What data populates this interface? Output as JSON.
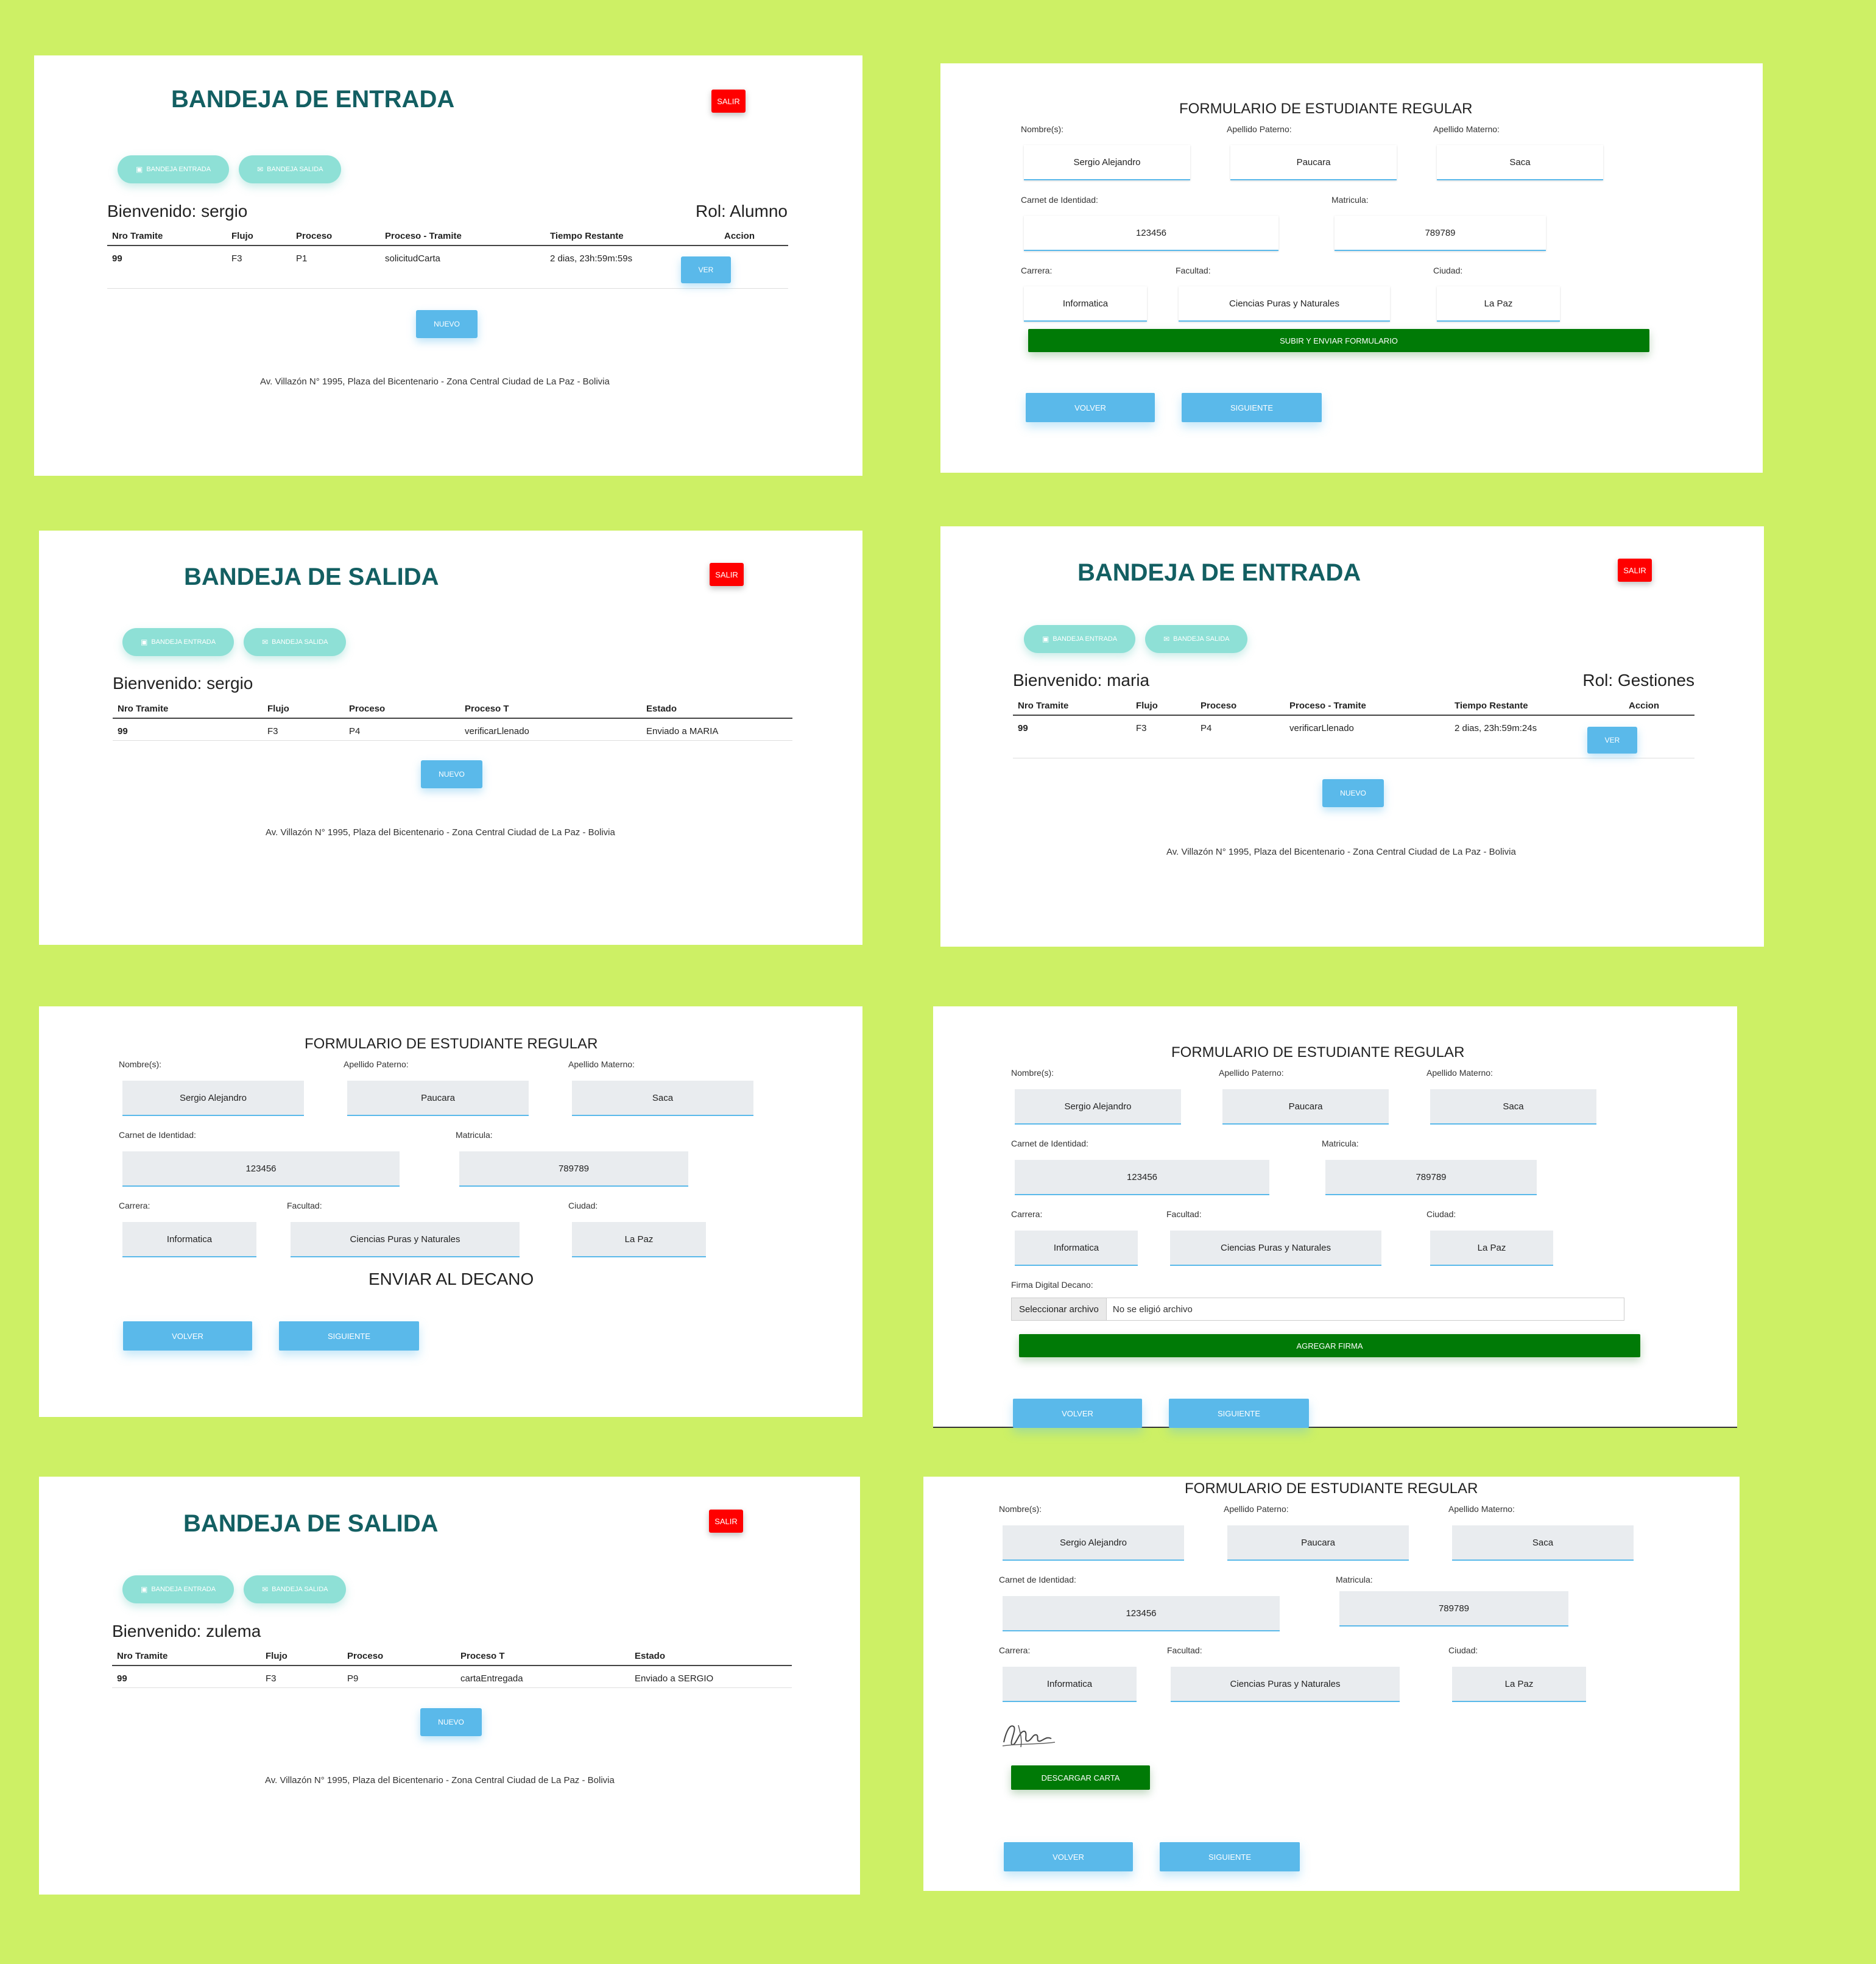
{
  "inbox": {
    "title": "BANDEJA DE ENTRADA",
    "salir": "SALIR",
    "nav_entrada": "BANDEJA ENTRADA",
    "nav_salida": "BANDEJA SALIDA",
    "headers": [
      "Nro Tramite",
      "Flujo",
      "Proceso",
      "Proceso - Tramite",
      "Tiempo Restante",
      "Accion"
    ],
    "ver": "VER",
    "nuevo": "NUEVO",
    "footer": "Av. Villazón N° 1995, Plaza del Bicentenario - Zona Central Ciudad de La Paz - Bolivia"
  },
  "outbox": {
    "title": "BANDEJA DE SALIDA",
    "headers": [
      "Nro Tramite",
      "Flujo",
      "Proceso",
      "Proceso T",
      "Estado"
    ]
  },
  "p1": {
    "welcome": "Bienvenido: sergio",
    "rol": "Rol: Alumno",
    "row": {
      "nro": "99",
      "flujo": "F3",
      "proceso": "P1",
      "tramite": "solicitudCarta",
      "tiempo": "2 dias, 23h:59m:59s"
    }
  },
  "p3": {
    "welcome": "Bienvenido: sergio",
    "row": {
      "nro": "99",
      "flujo": "F3",
      "proceso": "P4",
      "tramite": "verificarLlenado",
      "estado": "Enviado a MARIA"
    }
  },
  "p4": {
    "welcome": "Bienvenido: maria",
    "rol": "Rol: Gestiones",
    "row": {
      "nro": "99",
      "flujo": "F3",
      "proceso": "P4",
      "tramite": "verificarLlenado",
      "tiempo": "2 dias, 23h:59m:24s"
    }
  },
  "p7": {
    "welcome": "Bienvenido: zulema",
    "row": {
      "nro": "99",
      "flujo": "F3",
      "proceso": "P9",
      "tramite": "cartaEntregada",
      "estado": "Enviado a SERGIO"
    }
  },
  "form": {
    "title": "FORMULARIO DE ESTUDIANTE REGULAR",
    "labels": {
      "nombre": "Nombre(s):",
      "paterno": "Apellido Paterno:",
      "materno": "Apellido Materno:",
      "ci": "Carnet de Identidad:",
      "matricula": "Matricula:",
      "carrera": "Carrera:",
      "facultad": "Facultad:",
      "ciudad": "Ciudad:",
      "firma": "Firma Digital Decano:"
    },
    "values": {
      "nombre": "Sergio Alejandro",
      "paterno": "Paucara",
      "materno": "Saca",
      "ci": "123456",
      "matricula": "789789",
      "carrera": "Informatica",
      "facultad": "Ciencias Puras y Naturales",
      "ciudad": "La Paz"
    },
    "subir": "SUBIR Y ENVIAR FORMULARIO",
    "enviar_decano": "ENVIAR AL DECANO",
    "file_button": "Seleccionar archivo",
    "file_none": "No se eligió archivo",
    "agregar_firma": "AGREGAR FIRMA",
    "descargar": "DESCARGAR CARTA",
    "volver": "VOLVER",
    "siguiente": "SIGUIENTE"
  },
  "colors": {
    "background": "#cdf065",
    "title": "#135f62",
    "salir": "#ff0000",
    "pill": "#8ee0d6",
    "button": "#5ab9ea",
    "green": "#007a06"
  },
  "icons": [
    "inbox-icon",
    "envelope-icon",
    "signature-image"
  ]
}
